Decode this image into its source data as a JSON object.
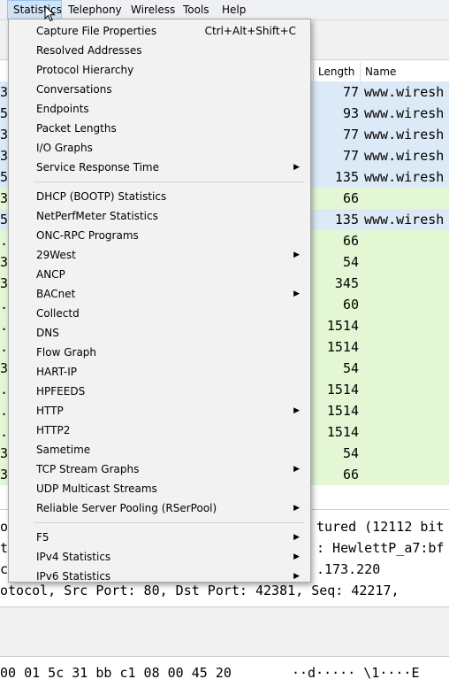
{
  "menubar": {
    "items": [
      {
        "label": "Statistics"
      },
      {
        "label": "Telephony"
      },
      {
        "label": "Wireless"
      },
      {
        "label": "Tools"
      },
      {
        "label": "Help"
      }
    ]
  },
  "packet_list": {
    "headers": {
      "length": "Length",
      "name": "Name"
    },
    "rows": [
      {
        "edge": "3",
        "length": "77",
        "name": "www.wiresh",
        "bg": "#dceaf7"
      },
      {
        "edge": "5",
        "length": "93",
        "name": "www.wiresh",
        "bg": "#dceaf7"
      },
      {
        "edge": "3",
        "length": "77",
        "name": "www.wiresh",
        "bg": "#dceaf7"
      },
      {
        "edge": "3",
        "length": "77",
        "name": "www.wiresh",
        "bg": "#dceaf7"
      },
      {
        "edge": "5",
        "length": "135",
        "name": "www.wiresh",
        "bg": "#dceaf7"
      },
      {
        "edge": "3",
        "length": "66",
        "name": "",
        "bg": "#e4f7d4"
      },
      {
        "edge": "5",
        "length": "135",
        "name": "www.wiresh",
        "bg": "#dceaf7"
      },
      {
        "edge": ".",
        "length": "66",
        "name": "",
        "bg": "#e4f7d4"
      },
      {
        "edge": "3",
        "length": "54",
        "name": "",
        "bg": "#e4f7d4"
      },
      {
        "edge": "3",
        "length": "345",
        "name": "",
        "bg": "#e4f7d4"
      },
      {
        "edge": ".",
        "length": "60",
        "name": "",
        "bg": "#e4f7d4"
      },
      {
        "edge": ".",
        "length": "1514",
        "name": "",
        "bg": "#e4f7d4"
      },
      {
        "edge": ".",
        "length": "1514",
        "name": "",
        "bg": "#e4f7d4"
      },
      {
        "edge": "3",
        "length": "54",
        "name": "",
        "bg": "#e4f7d4"
      },
      {
        "edge": ".",
        "length": "1514",
        "name": "",
        "bg": "#e4f7d4"
      },
      {
        "edge": ".",
        "length": "1514",
        "name": "",
        "bg": "#e4f7d4"
      },
      {
        "edge": ".",
        "length": "1514",
        "name": "",
        "bg": "#e4f7d4"
      },
      {
        "edge": "3",
        "length": "54",
        "name": "",
        "bg": "#e4f7d4"
      },
      {
        "edge": "3",
        "length": "66",
        "name": "",
        "bg": "#e4f7d4"
      }
    ]
  },
  "details": {
    "lines": [
      {
        "left": "or",
        "right": "tured (12112 bit"
      },
      {
        "left": "t",
        "right": ": HewlettP_a7:bf"
      },
      {
        "left": "c",
        "right": ".173.220"
      },
      {
        "left": "otocol, Src Port: 80, Dst Port: 42381, Seq: 42217,",
        "right": ""
      }
    ]
  },
  "hex": {
    "bytes": "00 01  5c 31 bb c1 08 00 45 20",
    "ascii": "··d·····  \\1····E "
  },
  "statistics_menu": {
    "items": [
      {
        "label": "Capture File Properties",
        "shortcut": "Ctrl+Alt+Shift+C"
      },
      {
        "label": "Resolved Addresses"
      },
      {
        "label": "Protocol Hierarchy"
      },
      {
        "label": "Conversations"
      },
      {
        "label": "Endpoints"
      },
      {
        "label": "Packet Lengths"
      },
      {
        "label": "I/O Graphs"
      },
      {
        "label": "Service Response Time",
        "submenu": true
      },
      {
        "separator": true
      },
      {
        "label": "DHCP (BOOTP) Statistics"
      },
      {
        "label": "NetPerfMeter Statistics"
      },
      {
        "label": "ONC-RPC Programs"
      },
      {
        "label": "29West",
        "submenu": true
      },
      {
        "label": "ANCP"
      },
      {
        "label": "BACnet",
        "submenu": true
      },
      {
        "label": "Collectd"
      },
      {
        "label": "DNS"
      },
      {
        "label": "Flow Graph"
      },
      {
        "label": "HART-IP"
      },
      {
        "label": "HPFEEDS"
      },
      {
        "label": "HTTP",
        "submenu": true
      },
      {
        "label": "HTTP2"
      },
      {
        "label": "Sametime"
      },
      {
        "label": "TCP Stream Graphs",
        "submenu": true
      },
      {
        "label": "UDP Multicast Streams"
      },
      {
        "label": "Reliable Server Pooling (RSerPool)",
        "submenu": true
      },
      {
        "separator": true
      },
      {
        "label": "F5",
        "submenu": true
      },
      {
        "label": "IPv4 Statistics",
        "submenu": true
      },
      {
        "label": "IPv6 Statistics",
        "submenu": true
      }
    ]
  }
}
